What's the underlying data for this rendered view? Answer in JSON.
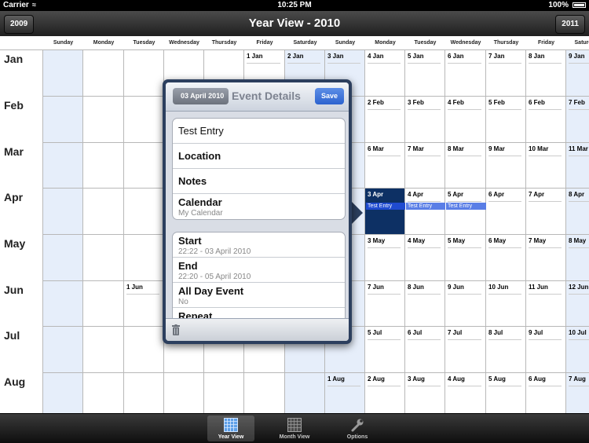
{
  "status": {
    "carrier": "Carrier",
    "time": "10:25 PM",
    "battery": "100%"
  },
  "nav": {
    "title": "Year View - 2010",
    "prev_year": "2009",
    "next_year": "2011"
  },
  "day_headers": [
    "Sunday",
    "Monday",
    "Tuesday",
    "Wednesday",
    "Thursday",
    "Friday",
    "Saturday",
    "Sunday",
    "Monday",
    "Tuesday",
    "Wednesday",
    "Thursday",
    "Friday",
    "Saturday"
  ],
  "months": [
    {
      "label": "Jan",
      "days": [
        "",
        "",
        "",
        "",
        "",
        "1 Jan",
        "2 Jan",
        "3 Jan",
        "4 Jan",
        "5 Jan",
        "6 Jan",
        "7 Jan",
        "8 Jan",
        "9 Jan"
      ]
    },
    {
      "label": "Feb",
      "days": [
        "",
        "",
        "",
        "",
        "",
        "",
        "",
        "",
        "2 Feb",
        "3 Feb",
        "4 Feb",
        "5 Feb",
        "6 Feb",
        "7 Feb"
      ]
    },
    {
      "label": "Mar",
      "days": [
        "",
        "",
        "",
        "",
        "",
        "",
        "",
        "",
        "6 Mar",
        "7 Mar",
        "8 Mar",
        "9 Mar",
        "10 Mar",
        "11 Mar"
      ]
    },
    {
      "label": "Apr",
      "days": [
        "",
        "",
        "",
        "",
        "",
        "",
        "",
        "",
        "3 Apr",
        "4 Apr",
        "5 Apr",
        "6 Apr",
        "7 Apr",
        "8 Apr"
      ]
    },
    {
      "label": "May",
      "days": [
        "",
        "",
        "",
        "",
        "",
        "",
        "",
        "",
        "3 May",
        "4 May",
        "5 May",
        "6 May",
        "7 May",
        "8 May"
      ]
    },
    {
      "label": "Jun",
      "days": [
        "",
        "",
        "1 Jun",
        "",
        "",
        "",
        "",
        "",
        "7 Jun",
        "8 Jun",
        "9 Jun",
        "10 Jun",
        "11 Jun",
        "12 Jun"
      ]
    },
    {
      "label": "Jul",
      "days": [
        "",
        "",
        "",
        "",
        "",
        "",
        "",
        "",
        "5 Jul",
        "6 Jul",
        "7 Jul",
        "8 Jul",
        "9 Jul",
        "10 Jul"
      ]
    },
    {
      "label": "Aug",
      "days": [
        "",
        "",
        "",
        "",
        "",
        "",
        "",
        "1 Aug",
        "2 Aug",
        "3 Aug",
        "4 Aug",
        "5 Aug",
        "6 Aug",
        "7 Aug"
      ]
    }
  ],
  "selected_day": "3 Apr",
  "events": [
    {
      "day": "3 Apr",
      "label": "Test Entry"
    },
    {
      "day": "4 Apr",
      "label": "Test Entry"
    },
    {
      "day": "5 Apr",
      "label": "Test Entry"
    }
  ],
  "popover": {
    "back_label": "03 April 2010",
    "title": "Event Details",
    "save_label": "Save",
    "title_value": "Test Entry",
    "location_label": "Location",
    "notes_label": "Notes",
    "calendar_label": "Calendar",
    "calendar_value": "My Calendar",
    "start_label": "Start",
    "start_value": "22:22 - 03 April 2010",
    "end_label": "End",
    "end_value": "22:20 - 05 April 2010",
    "allday_label": "All Day Event",
    "allday_value": "No",
    "repeat_label": "Repeat"
  },
  "tabs": [
    {
      "label": "Year View",
      "icon": "year-grid-icon",
      "active": true
    },
    {
      "label": "Month View",
      "icon": "month-grid-icon",
      "active": false
    },
    {
      "label": "Options",
      "icon": "wrench-icon",
      "active": false
    }
  ],
  "colors": {
    "selected_day": "#0d3064",
    "event": "#5a7ee6",
    "weekend": "#e6eefa",
    "save": "#2c63cf"
  }
}
